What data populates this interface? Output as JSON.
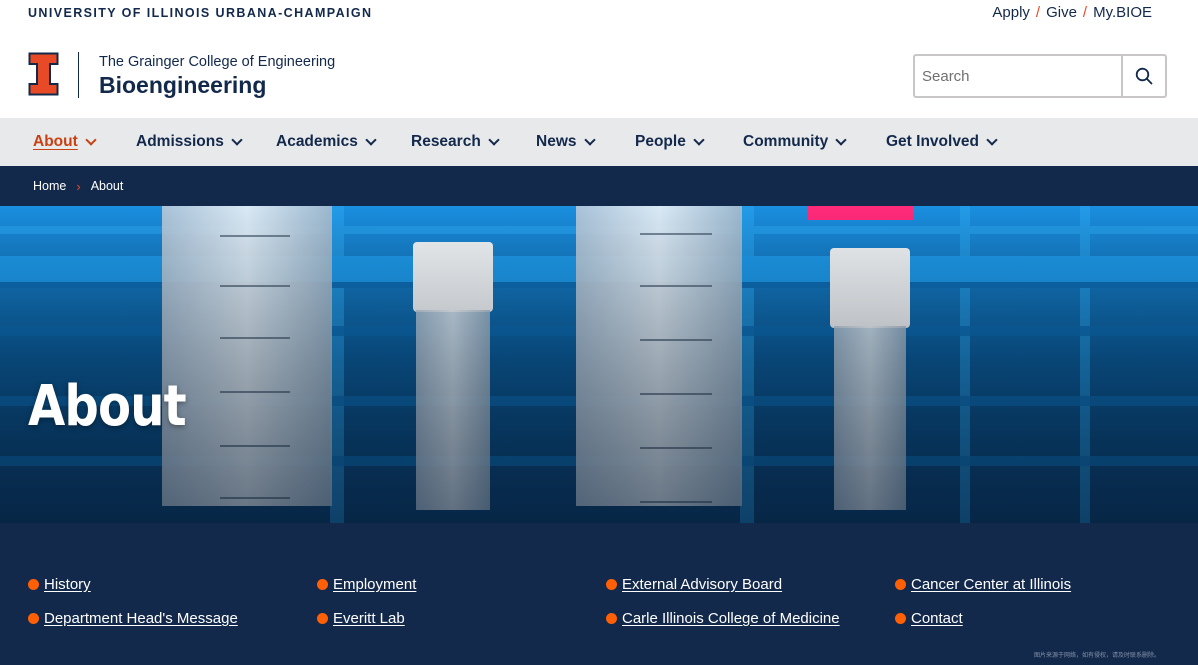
{
  "topbar": {
    "university": "UNIVERSITY OF ILLINOIS URBANA-CHAMPAIGN",
    "links": [
      "Apply",
      "Give",
      "My.BIOE"
    ],
    "separator": "/"
  },
  "header": {
    "college": "The Grainger College of Engineering",
    "department": "Bioengineering",
    "search_placeholder": "Search",
    "brand_orange": "#e84a27",
    "brand_blue": "#13294b"
  },
  "nav": {
    "items": [
      "About",
      "Admissions",
      "Academics",
      "Research",
      "News",
      "People",
      "Community",
      "Get Involved"
    ],
    "active": "About"
  },
  "breadcrumb": {
    "home": "Home",
    "current": "About"
  },
  "hero": {
    "title": "About"
  },
  "links": {
    "items": [
      "History",
      "Employment",
      "External Advisory Board",
      "Cancer Center at Illinois",
      "Department Head's Message",
      "Everitt Lab",
      "Carle Illinois College of Medicine",
      "Contact"
    ]
  },
  "watermark": "图片来源于网络，如有侵权，请及时联系删除。"
}
